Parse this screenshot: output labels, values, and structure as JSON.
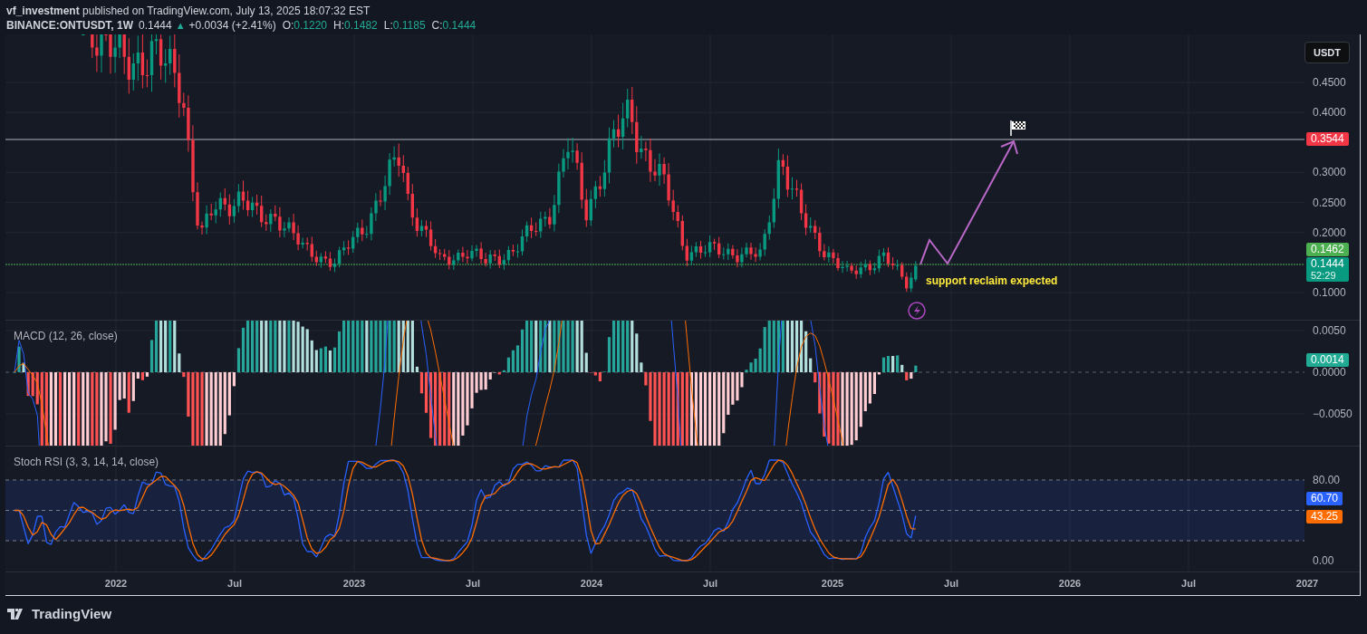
{
  "header": {
    "author": "vf_investment",
    "published": "published on TradingView.com, July 13, 2025 18:07:32 EST",
    "symbol": "BINANCE:ONTUSDT, 1W",
    "last": "0.1444",
    "arrow": "▲",
    "change": "+0.0034 (+2.41%)",
    "ohlc": [
      {
        "label": "O:",
        "value": "0.1220"
      },
      {
        "label": "H:",
        "value": "0.1482"
      },
      {
        "label": "L:",
        "value": "0.1185"
      },
      {
        "label": "C:",
        "value": "0.1444"
      }
    ]
  },
  "currency_button": "USDT",
  "price_axis": [
    "0.4500",
    "0.4000",
    "0.3000",
    "0.2500",
    "0.2000",
    "0.1000"
  ],
  "price_tags": [
    {
      "price": "0.3544",
      "color": "#f23645"
    },
    {
      "price": "0.1462",
      "color": "#4caf50"
    },
    {
      "price": "0.1444",
      "countdown": "52:29",
      "color": "#089981"
    }
  ],
  "annotation": "support reclaim expected",
  "macd": {
    "title": "MACD (12, 26, close)",
    "axis": [
      "0.0050",
      "0.0000",
      "−0.0050"
    ],
    "tag": {
      "value": "0.0014",
      "color": "#22ab94"
    }
  },
  "stoch_rsi": {
    "title": "Stoch RSI (3, 3, 14, 14, close)",
    "axis": [
      "80.00",
      "0.00"
    ],
    "tags": [
      {
        "value": "60.70",
        "color": "#2962ff"
      },
      {
        "value": "43.25",
        "color": "#ff6d00"
      }
    ]
  },
  "time_axis": [
    "2022",
    "Jul",
    "2023",
    "Jul",
    "2024",
    "Jul",
    "2025",
    "Jul",
    "2026",
    "Jul",
    "2027"
  ],
  "footer": {
    "brand": "TradingView"
  }
}
